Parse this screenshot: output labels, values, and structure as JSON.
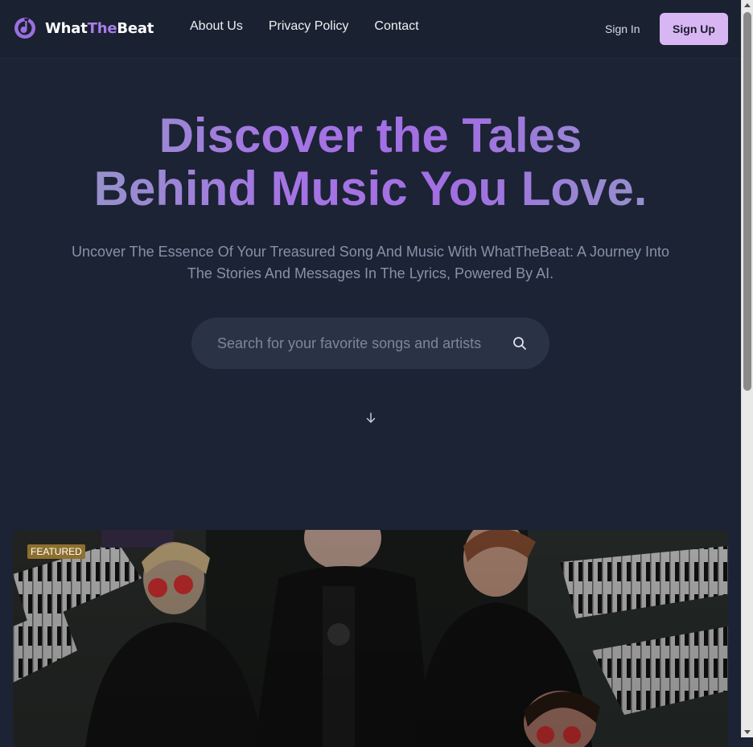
{
  "header": {
    "logo_prefix": "What",
    "logo_accent": "The",
    "logo_suffix": "Beat",
    "nav": [
      "About Us",
      "Privacy Policy",
      "Contact"
    ],
    "sign_in": "Sign In",
    "sign_up": "Sign Up"
  },
  "hero": {
    "title_line1": "Discover the Tales",
    "title_line2": "Behind Music You Love.",
    "subtitle_line1": "Uncover The Essence Of Your Treasured Song And Music With WhatTheBeat: A Journey Into",
    "subtitle_line2": "The Stories And Messages In The Lyrics, Powered By AI."
  },
  "search": {
    "placeholder": "Search for your favorite songs and artists",
    "value": ""
  },
  "featured": {
    "badge": "FEATURED"
  },
  "icons": {
    "logo": "music-note-logo-icon",
    "search": "search-icon",
    "scroll": "arrow-down-icon"
  },
  "colors": {
    "background": "#1c2334",
    "header": "#1a2130",
    "accent": "#a87dea",
    "sign_up_bg": "#d8b6f4",
    "search_bg": "#2a3345",
    "badge_bg": "#8d6f2e"
  }
}
